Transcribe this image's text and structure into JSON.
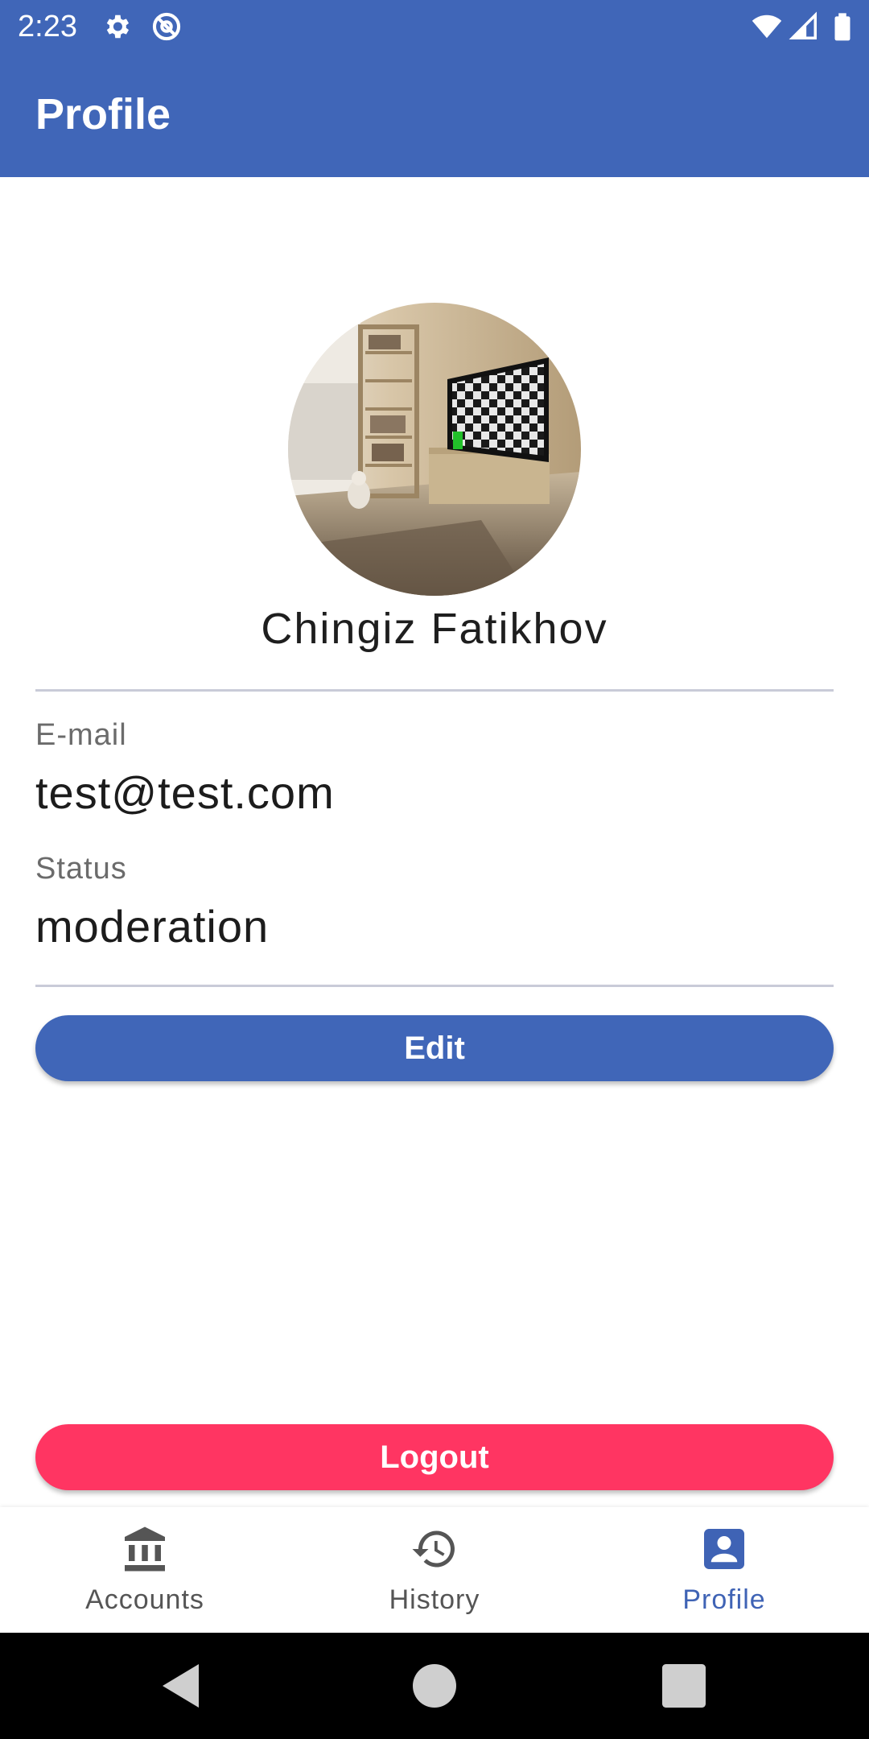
{
  "status_bar": {
    "time": "2:23",
    "icons": [
      "gear-icon",
      "at-sign-icon",
      "wifi-icon",
      "signal-icon",
      "battery-icon"
    ]
  },
  "app_bar": {
    "title": "Profile"
  },
  "profile": {
    "avatar_icon": "avatar-photo",
    "name": "Chingiz Fatikhov",
    "email_label": "E-mail",
    "email_value": "test@test.com",
    "status_label": "Status",
    "status_value": "moderation"
  },
  "actions": {
    "edit_label": "Edit",
    "logout_label": "Logout"
  },
  "bottom_nav": {
    "items": [
      {
        "label": "Accounts",
        "icon": "bank-icon",
        "active": false
      },
      {
        "label": "History",
        "icon": "history-icon",
        "active": false
      },
      {
        "label": "Profile",
        "icon": "profile-icon",
        "active": true
      }
    ]
  },
  "colors": {
    "primary": "#4066b8",
    "logout": "#ff3562",
    "nav_active": "#3f63b5",
    "nav_inactive": "#555555"
  }
}
